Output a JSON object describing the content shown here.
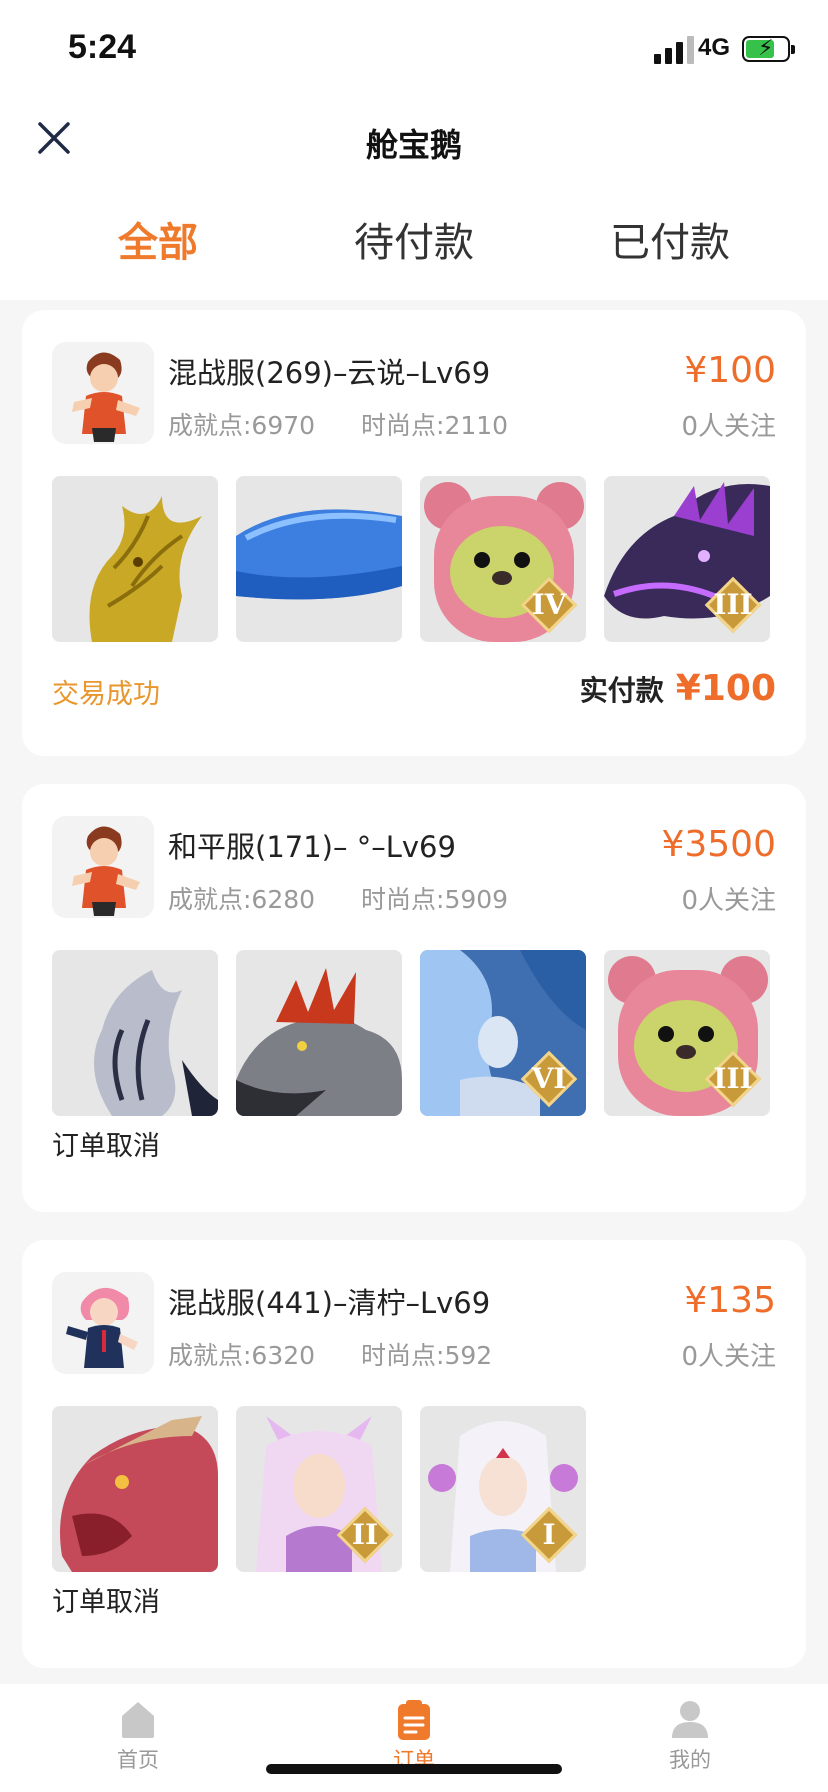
{
  "status_bar": {
    "time": "5:24",
    "network": "4G"
  },
  "nav": {
    "title": "舱宝鹅"
  },
  "tabs": [
    {
      "label": "全部",
      "active": true
    },
    {
      "label": "待付款",
      "active": false
    },
    {
      "label": "已付款",
      "active": false
    }
  ],
  "orders": [
    {
      "title": "混战服(269)–云说–Lv69",
      "achievement": "成就点:6970",
      "fashion": "时尚点:2110",
      "price": "¥100",
      "followers": "0人关注",
      "thumbs": [
        {
          "icon": "golden-dragon-icon",
          "badge": ""
        },
        {
          "icon": "blue-whale-icon",
          "badge": ""
        },
        {
          "icon": "pink-bear-icon",
          "badge": "IV"
        },
        {
          "icon": "purple-dragon-icon",
          "badge": "III"
        }
      ],
      "status": "交易成功",
      "paid_label": "实付款",
      "paid_amount": "¥100"
    },
    {
      "title": "和平服(171)–  °–Lv69",
      "achievement": "成就点:6280",
      "fashion": "时尚点:5909",
      "price": "¥3500",
      "followers": "0人关注",
      "thumbs": [
        {
          "icon": "silver-dragon-icon",
          "badge": ""
        },
        {
          "icon": "red-crest-dragon-icon",
          "badge": ""
        },
        {
          "icon": "ice-maiden-icon",
          "badge": "VI"
        },
        {
          "icon": "pink-bear-icon",
          "badge": "III"
        }
      ],
      "status": "订单取消"
    },
    {
      "title": "混战服(441)–清柠–Lv69",
      "achievement": "成就点:6320",
      "fashion": "时尚点:592",
      "price": "¥135",
      "followers": "0人关注",
      "thumbs": [
        {
          "icon": "red-dragon-icon",
          "badge": ""
        },
        {
          "icon": "fox-girl-icon",
          "badge": "II"
        },
        {
          "icon": "white-hair-girl-icon",
          "badge": "I"
        }
      ],
      "status": "订单取消"
    }
  ],
  "tabbar": [
    {
      "label": "首页",
      "icon": "home-icon",
      "active": false
    },
    {
      "label": "订单",
      "icon": "order-icon",
      "active": true
    },
    {
      "label": "我的",
      "icon": "profile-icon",
      "active": false
    }
  ],
  "colors": {
    "accent": "#f07a2c",
    "price": "#ee6d2a",
    "success": "#e9962d",
    "background": "#f6f6f6"
  }
}
